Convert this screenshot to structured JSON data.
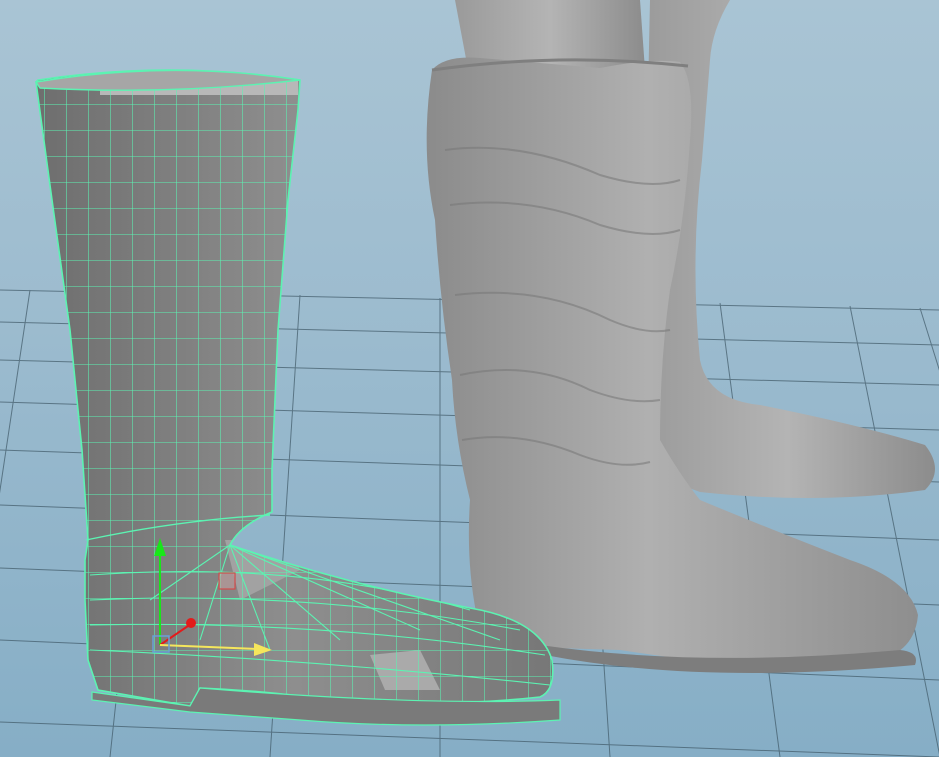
{
  "viewport": {
    "name": "3D Viewport",
    "colors": {
      "background_top": "#a9c4d4",
      "background_bottom": "#86aec6",
      "grid_line": "#3f5866",
      "wireframe": "#5cf3b2",
      "mesh_fill": "#8a8a8a",
      "sculpt_fill": "#9a9a9a",
      "manipulator_y": "#19e619",
      "manipulator_x": "#e31b1b",
      "manipulator_z": "#f5e65c",
      "manipulator_center": "#6aa0d8",
      "selected_face": "#c8a0a0"
    },
    "objects": [
      {
        "id": "lowpoly-boot",
        "kind": "polygon mesh (wireframe on shaded)"
      },
      {
        "id": "sculpted-boot",
        "kind": "high-resolution sculpt"
      },
      {
        "id": "character-legs",
        "kind": "character mesh"
      }
    ],
    "manipulator": {
      "type": "move",
      "axes": [
        "x",
        "y",
        "z"
      ]
    }
  }
}
